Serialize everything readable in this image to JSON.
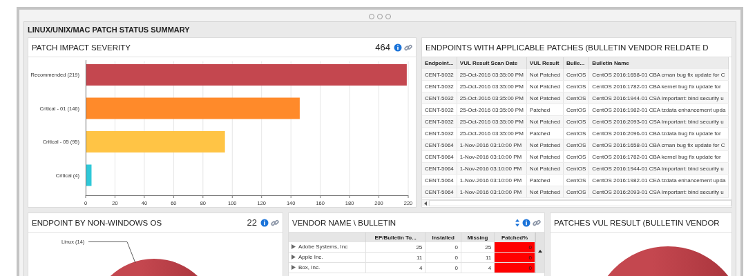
{
  "window": {
    "title": "LINUX/UNIX/MAC PATCH STATUS SUMMARY"
  },
  "patch_impact_severity": {
    "title": "PATCH IMPACT SEVERITY",
    "count": "464",
    "chart_data": {
      "type": "bar",
      "orientation": "horizontal",
      "stacked": true,
      "categories": [
        "Recommended (219)",
        "Critical - 01 (146)",
        "Critical - 05 (95)",
        "Critical (4)"
      ],
      "series": [
        {
          "color": "#c4474f",
          "values": [
            219,
            null,
            null,
            null
          ]
        },
        {
          "color": "#ff8a2a",
          "values": [
            null,
            146,
            null,
            null
          ]
        },
        {
          "color": "#ffc445",
          "values": [
            null,
            null,
            95,
            null
          ]
        },
        {
          "color": "#2fc8d8",
          "values": [
            null,
            null,
            null,
            4
          ]
        }
      ],
      "xlim": [
        0,
        220
      ],
      "grid": true,
      "xticks": [
        0,
        20,
        40,
        60,
        80,
        100,
        120,
        140,
        160,
        180,
        200,
        220
      ]
    }
  },
  "endpoints_table": {
    "title": "ENDPOINTS WITH APPLICABLE PATCHES (BULLETIN VENDOR RELDATE D",
    "columns": [
      "Endpoint...",
      "VUL Result Scan Date",
      "VUL Result",
      "Bulle...",
      "Bulletin Name"
    ],
    "rows": [
      [
        "CENT-5032",
        "25-Oct-2016 03:35:00 PM",
        "Not Patched",
        "CentOS",
        "CentOS 2016:1658-01 CBA cman bug fix update for C"
      ],
      [
        "CENT-5032",
        "25-Oct-2016 03:35:00 PM",
        "Not Patched",
        "CentOS",
        "CentOS 2016:1782-01 CBA kernel bug fix update for"
      ],
      [
        "CENT-5032",
        "25-Oct-2016 03:35:00 PM",
        "Not Patched",
        "CentOS",
        "CentOS 2016:1944-01 CSA Important: bind security u"
      ],
      [
        "CENT-5032",
        "25-Oct-2016 03:35:00 PM",
        "Patched",
        "CentOS",
        "CentOS 2016:1982-01 CEA tzdata enhancement upda"
      ],
      [
        "CENT-5032",
        "25-Oct-2016 03:35:00 PM",
        "Not Patched",
        "CentOS",
        "CentOS 2016:2093-01 CSA Important: bind security u"
      ],
      [
        "CENT-5032",
        "25-Oct-2016 03:35:00 PM",
        "Patched",
        "CentOS",
        "CentOS 2016:2096-01 CBA tzdata bug fix update for"
      ],
      [
        "CENT-5064",
        "1-Nov-2016 03:10:00 PM",
        "Not Patched",
        "CentOS",
        "CentOS 2016:1658-01 CBA cman bug fix update for C"
      ],
      [
        "CENT-5064",
        "1-Nov-2016 03:10:00 PM",
        "Not Patched",
        "CentOS",
        "CentOS 2016:1782-01 CBA kernel bug fix update for"
      ],
      [
        "CENT-5064",
        "1-Nov-2016 03:10:00 PM",
        "Not Patched",
        "CentOS",
        "CentOS 2016:1944-01 CSA Important: bind security u"
      ],
      [
        "CENT-5064",
        "1-Nov-2016 03:10:00 PM",
        "Patched",
        "CentOS",
        "CentOS 2016:1982-01 CEA tzdata enhancement upda"
      ],
      [
        "CENT-5064",
        "1-Nov-2016 03:10:00 PM",
        "Not Patched",
        "CentOS",
        "CentOS 2016:2093-01 CSA Important: bind security u"
      ]
    ]
  },
  "endpoint_by_os": {
    "title": "ENDPOINT BY NON-WINDOWS OS",
    "count": "22",
    "pie_label": "Linux (14)"
  },
  "vendor_bulletin": {
    "title": "VENDOR NAME \\ BULLETIN",
    "columns": [
      "EP/Bulletin To...",
      "Installed",
      "Missing",
      "Patched%"
    ],
    "rows": [
      {
        "name": "Adobe Systems, Inc",
        "values": [
          "25",
          "0",
          "25",
          "0"
        ]
      },
      {
        "name": "Apple Inc.",
        "values": [
          "11",
          "0",
          "11",
          "0"
        ]
      },
      {
        "name": "Box, Inc.",
        "values": [
          "4",
          "0",
          "4",
          "0"
        ]
      }
    ]
  },
  "patches_vul_result": {
    "title": "PATCHES VUL RESULT (BULLETIN VENDOR"
  }
}
